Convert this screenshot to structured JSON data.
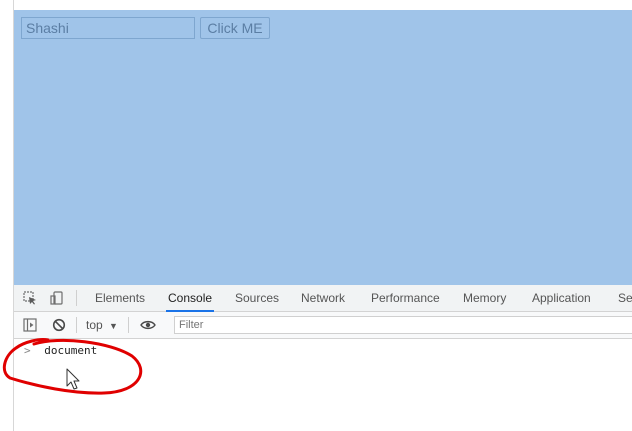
{
  "page": {
    "input_value": "Shashi",
    "button_label": "Click ME"
  },
  "devtools": {
    "tabs": [
      {
        "label": "Elements"
      },
      {
        "label": "Console",
        "active": true
      },
      {
        "label": "Sources"
      },
      {
        "label": "Network"
      },
      {
        "label": "Performance"
      },
      {
        "label": "Memory"
      },
      {
        "label": "Application"
      },
      {
        "label": "Se"
      }
    ],
    "context": "top",
    "filter_placeholder": "Filter",
    "console_input": "document",
    "prompt_symbol": ">"
  },
  "colors": {
    "page_background": "#a0c4e9",
    "active_tab_underline": "#1a73e8",
    "annotation": "#e00000"
  },
  "icons": {
    "inspect": "inspect-element-icon",
    "device": "device-toggle-icon",
    "sidebar": "console-sidebar-icon",
    "clear": "clear-console-icon",
    "eye": "live-expression-eye-icon",
    "dropdown": "chevron-down-icon",
    "cursor": "mouse-pointer-icon"
  }
}
